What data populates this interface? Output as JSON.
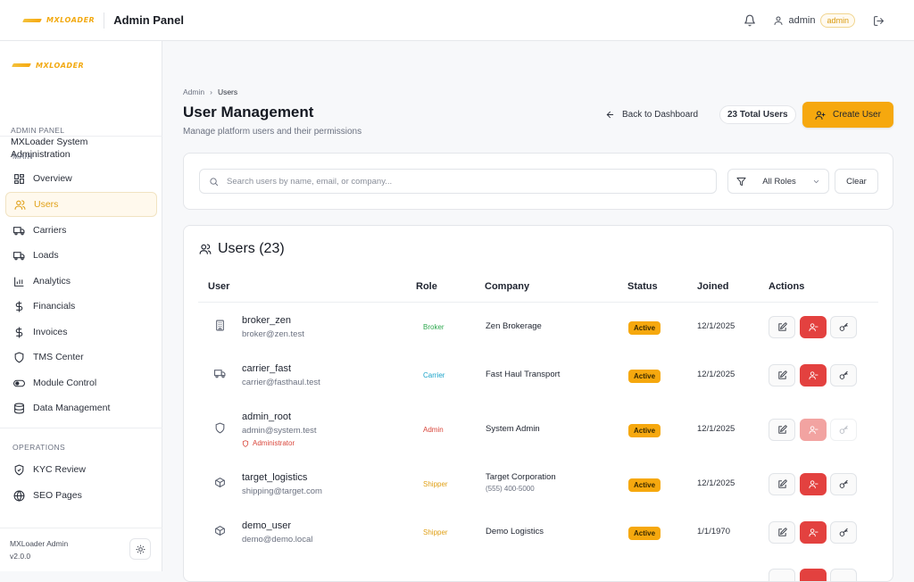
{
  "topbar": {
    "logo_text": "MXLOADER",
    "title": "Admin Panel",
    "user_name": "admin",
    "user_role": "admin"
  },
  "sidebar": {
    "logo_text": "MXLOADER",
    "panel_label": "ADMIN PANEL",
    "panel_name": "MXLoader System Administration",
    "sections": [
      {
        "label": "MAIN",
        "items": [
          {
            "label": "Overview",
            "icon": "grid-icon"
          },
          {
            "label": "Users",
            "icon": "users-icon",
            "active": true
          },
          {
            "label": "Carriers",
            "icon": "truck-icon"
          },
          {
            "label": "Loads",
            "icon": "truck-icon"
          },
          {
            "label": "Analytics",
            "icon": "bar-chart-icon"
          },
          {
            "label": "Financials",
            "icon": "dollar-icon"
          },
          {
            "label": "Invoices",
            "icon": "dollar-icon"
          },
          {
            "label": "TMS Center",
            "icon": "shield-icon"
          },
          {
            "label": "Module Control",
            "icon": "toggle-icon"
          },
          {
            "label": "Data Management",
            "icon": "database-icon"
          }
        ]
      },
      {
        "label": "OPERATIONS",
        "items": [
          {
            "label": "KYC Review",
            "icon": "shield-check-icon"
          },
          {
            "label": "SEO Pages",
            "icon": "globe-icon"
          }
        ]
      }
    ],
    "footer_app": "MXLoader Admin",
    "footer_version": "v2.0.0"
  },
  "page": {
    "breadcrumb": [
      "Admin",
      "Users"
    ],
    "title": "User Management",
    "subtitle": "Manage platform users and their permissions",
    "back_label": "Back to Dashboard",
    "total_label": "23 Total Users",
    "create_label": "Create User"
  },
  "filters": {
    "search_placeholder": "Search users by name, email, or company...",
    "role_value": "All Roles",
    "clear_label": "Clear"
  },
  "table": {
    "title": "Users (23)",
    "columns": [
      "User",
      "Role",
      "Company",
      "Status",
      "Joined",
      "Actions"
    ],
    "rows": [
      {
        "name": "broker_zen",
        "email": "broker@zen.test",
        "role": "Broker",
        "role_color": "#2fa84f",
        "company": "Zen Brokerage",
        "phone": "",
        "status": "Active",
        "joined": "12/1/2025",
        "icon": "building-icon",
        "admin_tag": ""
      },
      {
        "name": "carrier_fast",
        "email": "carrier@fasthaul.test",
        "role": "Carrier",
        "role_color": "#1aa3c9",
        "company": "Fast Haul Transport",
        "phone": "",
        "status": "Active",
        "joined": "12/1/2025",
        "icon": "truck-icon",
        "admin_tag": ""
      },
      {
        "name": "admin_root",
        "email": "admin@system.test",
        "role": "Admin",
        "role_color": "#d9463b",
        "company": "System Admin",
        "phone": "",
        "status": "Active",
        "joined": "12/1/2025",
        "icon": "shield-icon",
        "admin_tag": "Administrator"
      },
      {
        "name": "target_logistics",
        "email": "shipping@target.com",
        "role": "Shipper",
        "role_color": "#e0a016",
        "company": "Target Corporation",
        "phone": "(555) 400-5000",
        "status": "Active",
        "joined": "12/1/2025",
        "icon": "package-icon",
        "admin_tag": ""
      },
      {
        "name": "demo_user",
        "email": "demo@demo.local",
        "role": "Shipper",
        "role_color": "#e0a016",
        "company": "Demo Logistics",
        "phone": "",
        "status": "Active",
        "joined": "1/1/1970",
        "icon": "package-icon",
        "admin_tag": ""
      }
    ]
  }
}
